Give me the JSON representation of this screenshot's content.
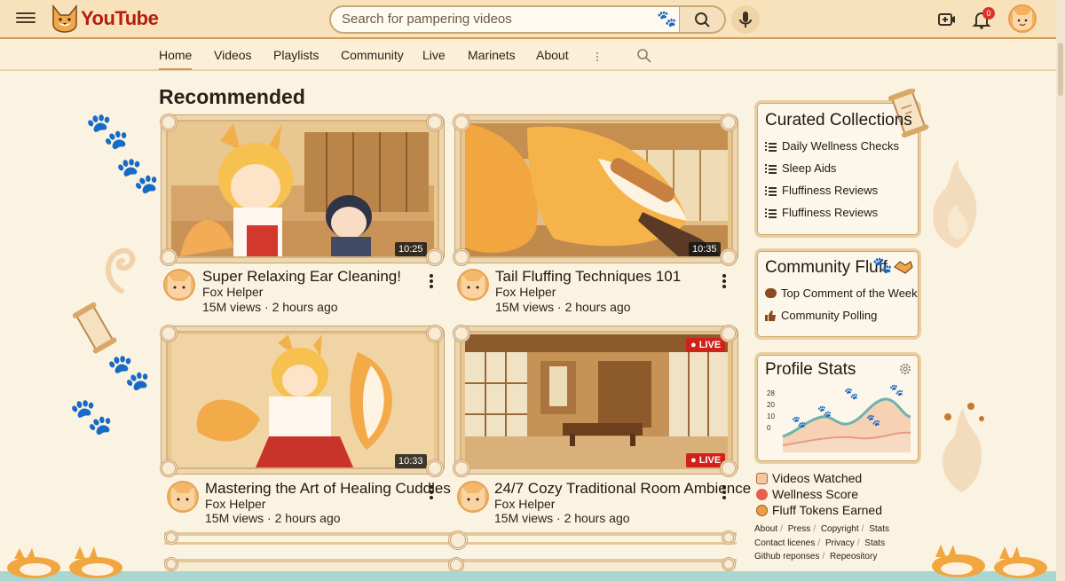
{
  "header": {
    "logo_text": "YouTube",
    "search_placeholder": "Search for pampering videos",
    "notification_count": "0"
  },
  "nav": {
    "tabs": [
      {
        "label": "Home",
        "active": true
      },
      {
        "label": "Videos"
      },
      {
        "label": "Playlists"
      },
      {
        "label": "Community"
      },
      {
        "label": "Live"
      },
      {
        "label": "Marinets"
      },
      {
        "label": "About"
      }
    ]
  },
  "main": {
    "heading": "Recommended",
    "videos": [
      {
        "title": "Super Relaxing Ear Cleaning!",
        "channel": "Fox Helper",
        "meta": "15M views · 2 hours ago",
        "duration": "10:25"
      },
      {
        "title": "Tail Fluffing Techniques 101",
        "channel": "Fox Helper",
        "meta": "15M views · 2 hours ago",
        "duration": "10:35"
      },
      {
        "title": "Mastering the Art of Healing Cuddles",
        "channel": "Fox Helper",
        "meta": "15M views · 2 hours ago",
        "duration": "10:33"
      },
      {
        "title": "24/7 Cozy Traditional Room Ambience",
        "channel": "Fox Helper",
        "meta": "15M views · 2 hours ago",
        "live_top": "LIVE",
        "live_bottom": "LIVE"
      }
    ]
  },
  "sidebar": {
    "curated": {
      "title": "Curated Collections",
      "items": [
        "Daily Wellness Checks",
        "Sleep Aids",
        "Fluffiness Reviews",
        "Fluffiness Reviews"
      ]
    },
    "community": {
      "title": "Community Fluff",
      "items": [
        "Top Comment of the Week",
        "Community Polling"
      ]
    },
    "profile_stats": {
      "title": "Profile Stats",
      "y_ticks": [
        "28",
        "20",
        "10",
        "0"
      ],
      "items": [
        "Videos Watched",
        "Wellness Score",
        "Fluff Tokens Earned"
      ]
    },
    "footer": {
      "row1": [
        "About",
        "Press",
        "Copyright",
        "Stats"
      ],
      "row2": [
        "Contact licenes",
        "Privacy",
        "Stats"
      ],
      "row3": [
        "Github reponses",
        "Repeository"
      ]
    }
  },
  "colors": {
    "accent": "#d49d56",
    "live": "#d0211b",
    "logo_red": "#b41e0f"
  }
}
